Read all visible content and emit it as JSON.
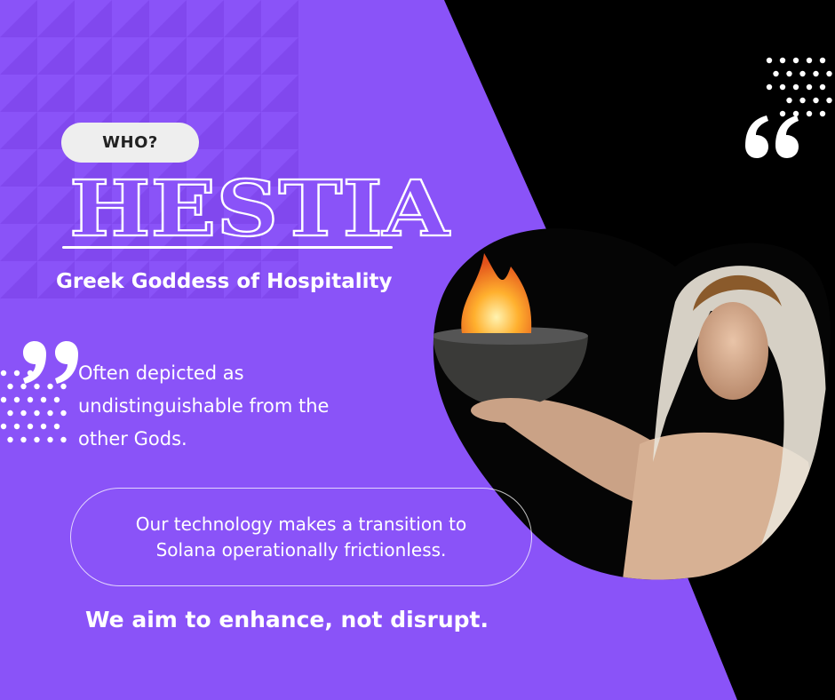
{
  "badge": {
    "label": "WHO?"
  },
  "hero": {
    "title": "HESTIA",
    "subtitle": "Greek Goddess of Hospitality"
  },
  "description": {
    "line1": "Often depicted as",
    "line2": "undistinguishable from the",
    "line3": "other Gods."
  },
  "callout": {
    "line1": "Our technology makes a transition to",
    "line2": "Solana operationally frictionless."
  },
  "tagline": {
    "text": "We aim to enhance, not disrupt."
  },
  "colors": {
    "purple": "#8a53f8",
    "pattern_dark": "#7a40e6",
    "black": "#000000",
    "white": "#ffffff",
    "pill": "#eeeeee"
  },
  "icons": [
    "quote-mark-icon",
    "dot-pattern",
    "triangle-pattern",
    "fire-bowl-photo"
  ]
}
